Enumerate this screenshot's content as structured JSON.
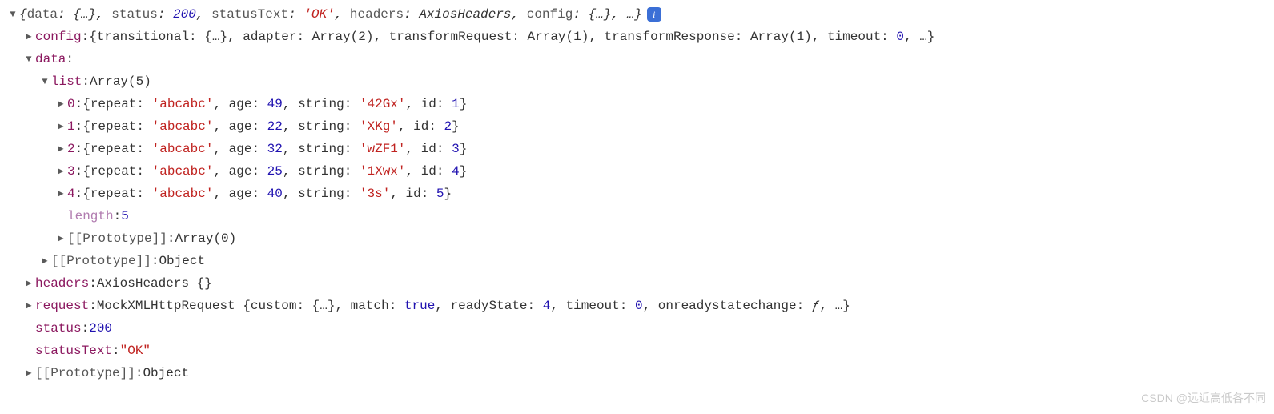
{
  "top": {
    "summary_prefix": "{",
    "data_k": "data",
    "data_v": "{…}",
    "status_k": "status",
    "status_v": "200",
    "statusText_k": "statusText",
    "statusText_q": "'OK'",
    "headers_k": "headers",
    "headers_v": "AxiosHeaders",
    "config_k": "config",
    "config_v": "{…}",
    "ellipsis": "…",
    "summary_suffix": "}",
    "info_glyph": "i"
  },
  "config": {
    "key": "config",
    "summary": "{transitional: {…}, adapter: Array(2), transformRequest: Array(1), transformResponse: Array(1), timeout: ",
    "timeout_v": "0",
    "tail": ", …}"
  },
  "data_key": "data",
  "list_key": "list",
  "list_type": "Array(5)",
  "items": [
    {
      "idx": "0",
      "repeat": "'abcabc'",
      "age": "49",
      "string": "'42Gx'",
      "id": "1"
    },
    {
      "idx": "1",
      "repeat": "'abcabc'",
      "age": "22",
      "string": "'XKg'",
      "id": "2"
    },
    {
      "idx": "2",
      "repeat": "'abcabc'",
      "age": "32",
      "string": "'wZF1'",
      "id": "3"
    },
    {
      "idx": "3",
      "repeat": "'abcabc'",
      "age": "25",
      "string": "'1Xwx'",
      "id": "4"
    },
    {
      "idx": "4",
      "repeat": "'abcabc'",
      "age": "40",
      "string": "'3s'",
      "id": "5"
    }
  ],
  "item_labels": {
    "repeat": "repeat",
    "age": "age",
    "string": "string",
    "id": "id"
  },
  "length": {
    "key": "length",
    "value": "5"
  },
  "proto_array": {
    "key": "[[Prototype]]",
    "value": "Array(0)"
  },
  "proto_obj1": {
    "key": "[[Prototype]]",
    "value": "Object"
  },
  "headers": {
    "key": "headers",
    "value": "AxiosHeaders {}"
  },
  "request": {
    "key": "request",
    "prefix": "MockXMLHttpRequest {custom: {…}, match: ",
    "match_v": "true",
    "mid1": ", readyState: ",
    "readyState_v": "4",
    "mid2": ", timeout: ",
    "timeout_v": "0",
    "mid3": ", onreadystatechange: ",
    "fn": "ƒ",
    "tail": ", …}"
  },
  "status": {
    "key": "status",
    "value": "200"
  },
  "statusText": {
    "key": "statusText",
    "value": "\"OK\""
  },
  "proto_obj2": {
    "key": "[[Prototype]]",
    "value": "Object"
  },
  "watermark": "CSDN @远近高低各不同"
}
